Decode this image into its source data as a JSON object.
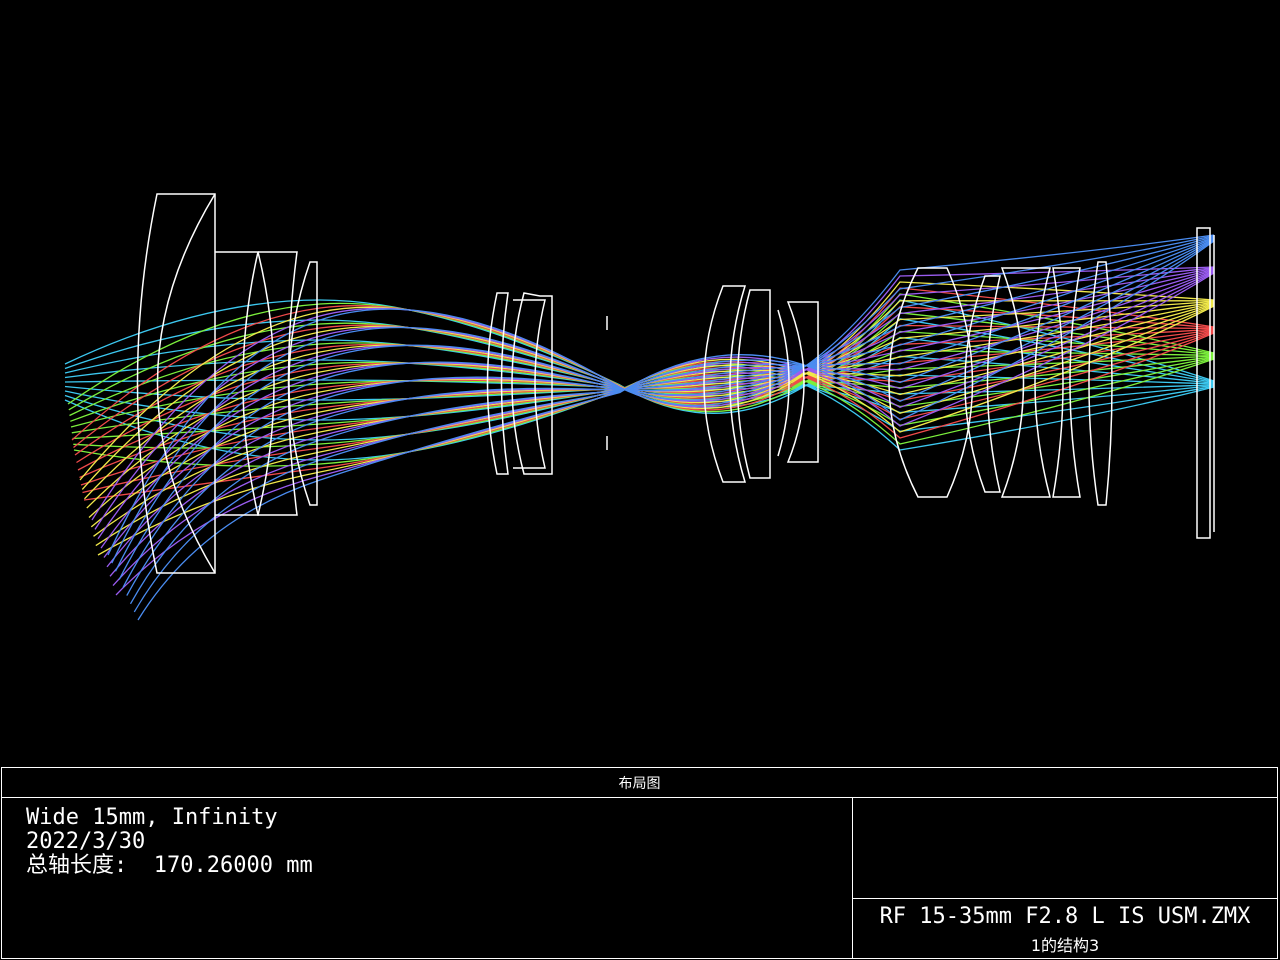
{
  "diagram": {
    "colors": {
      "lens": "#ffffff",
      "field1": "#3cc8f0",
      "field2": "#7cf03c",
      "field3": "#f04a4a",
      "field4": "#f0e84a",
      "field5": "#9a5cf0",
      "field6": "#4a8cf0"
    }
  },
  "footer": {
    "title": "布局图",
    "line1": "Wide 15mm, Infinity",
    "line2": "2022/3/30",
    "line3_label": "总轴长度:",
    "line3_value": "170.26000 mm",
    "filename": "RF 15-35mm F2.8 L IS USM.ZMX",
    "config": "1的结构3"
  }
}
